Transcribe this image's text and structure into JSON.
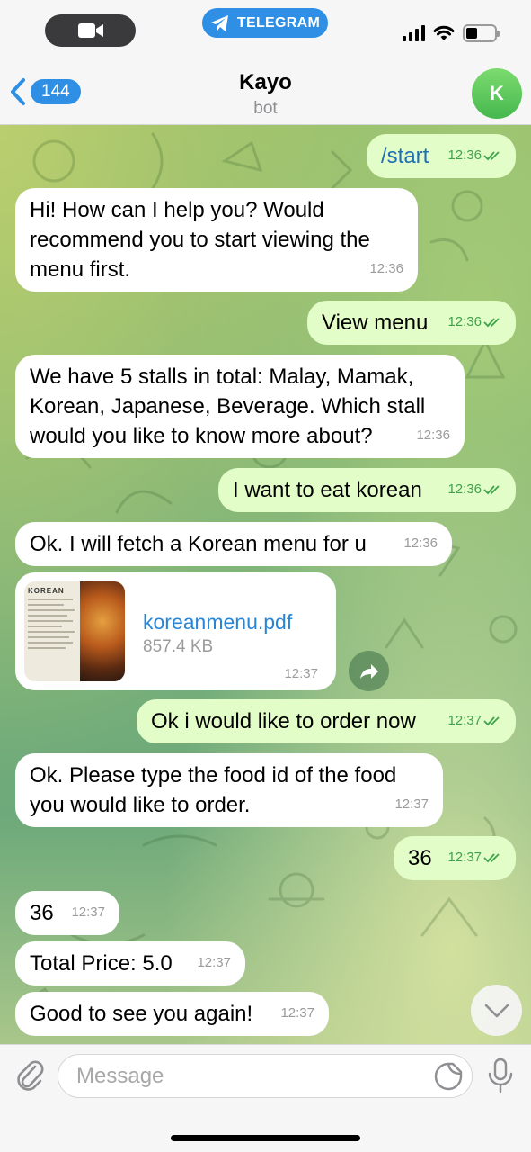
{
  "status_bar": {
    "app_pill": "TELEGRAM"
  },
  "header": {
    "back_count": "144",
    "title": "Kayo",
    "subtitle": "bot",
    "avatar_letter": "K"
  },
  "messages": [
    {
      "dir": "out",
      "text": "/start",
      "time": "12:36"
    },
    {
      "dir": "in",
      "text": "Hi! How can I help you? Would recommend you to start viewing the menu first.",
      "time": "12:36"
    },
    {
      "dir": "out",
      "text": "View menu",
      "time": "12:36"
    },
    {
      "dir": "in",
      "text": "We have 5 stalls in total: Malay, Mamak, Korean, Japanese, Beverage. Which stall would you like to know more about?",
      "time": "12:36"
    },
    {
      "dir": "out",
      "text": "I want to eat korean",
      "time": "12:36"
    },
    {
      "dir": "in",
      "text": "Ok. I will fetch a Korean menu for u",
      "time": "12:36"
    },
    {
      "dir": "out",
      "text": "Ok i would like to order now",
      "time": "12:37"
    },
    {
      "dir": "in",
      "text": "Ok. Please type the food id of the food you would like to order.",
      "time": "12:37"
    },
    {
      "dir": "out",
      "text": "36",
      "time": "12:37"
    },
    {
      "dir": "in",
      "text": "36",
      "time": "12:37"
    },
    {
      "dir": "in",
      "text": "Total Price: 5.0",
      "time": "12:37"
    },
    {
      "dir": "in",
      "text": "Good to see you again!",
      "time": "12:37"
    }
  ],
  "file_message": {
    "thumb_label": "KOREAN",
    "file_name": "koreanmenu.pdf",
    "file_size": "857.4 KB",
    "time": "12:37"
  },
  "composer": {
    "placeholder": "Message"
  },
  "colors": {
    "accent": "#2f8fe5",
    "outgoing_bubble": "#e2fdc7",
    "incoming_bubble": "#ffffff",
    "read_check": "#3fa34d",
    "link": "#2a86d4"
  }
}
